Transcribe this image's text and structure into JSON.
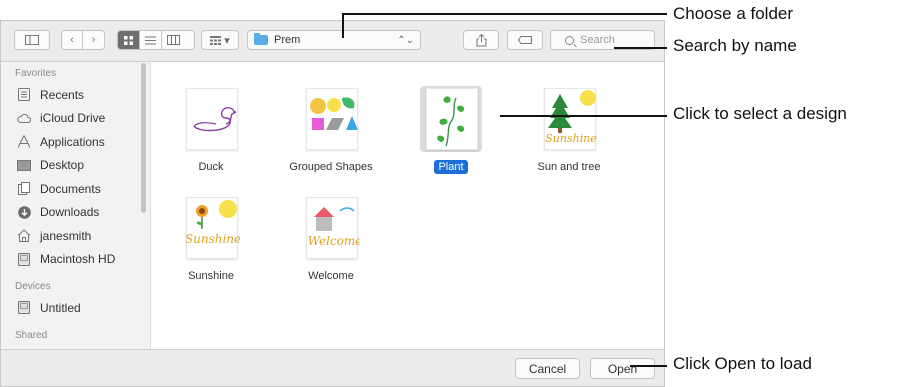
{
  "toolbar": {
    "view_icons": [
      "grid-icon",
      "list-icon",
      "columns-icon"
    ],
    "arrange_label": "▾",
    "path_folder": "Prem",
    "path_chevrons": "⌃⌄",
    "share_glyph": "⇪",
    "tag_glyph": "◯",
    "search_placeholder": "Search"
  },
  "sidebar": {
    "sections": [
      {
        "title": "Favorites",
        "items": [
          {
            "label": "Recents",
            "icon": "recents-icon"
          },
          {
            "label": "iCloud Drive",
            "icon": "cloud-icon"
          },
          {
            "label": "Applications",
            "icon": "applications-icon"
          },
          {
            "label": "Desktop",
            "icon": "desktop-icon"
          },
          {
            "label": "Documents",
            "icon": "documents-icon"
          },
          {
            "label": "Downloads",
            "icon": "downloads-icon"
          },
          {
            "label": "janesmith",
            "icon": "home-icon"
          },
          {
            "label": "Macintosh HD",
            "icon": "disk-icon"
          }
        ]
      },
      {
        "title": "Devices",
        "items": [
          {
            "label": "Untitled",
            "icon": "disk-icon"
          }
        ]
      },
      {
        "title": "Shared",
        "items": []
      }
    ]
  },
  "files": [
    {
      "name": "Duck",
      "icon": "duck-design-icon",
      "selected": false
    },
    {
      "name": "Grouped Shapes",
      "icon": "shapes-design-icon",
      "selected": false
    },
    {
      "name": "Plant",
      "icon": "plant-design-icon",
      "selected": true
    },
    {
      "name": "Sun and tree",
      "icon": "sun-tree-design-icon",
      "selected": false,
      "thumb_text": "Sunshine"
    },
    {
      "name": "Sunshine",
      "icon": "sunshine-design-icon",
      "selected": false,
      "thumb_text": "Sunshine"
    },
    {
      "name": "Welcome",
      "icon": "welcome-design-icon",
      "selected": false,
      "thumb_text": "Welcome"
    }
  ],
  "footer": {
    "cancel_label": "Cancel",
    "open_label": "Open"
  },
  "callouts": {
    "choose_folder": "Choose a folder",
    "search_by_name": "Search by name",
    "select_design": "Click to select a design",
    "open_to_load": "Click Open to load"
  },
  "colors": {
    "selection": "#1b6fd6",
    "folder": "#5aaee8"
  }
}
